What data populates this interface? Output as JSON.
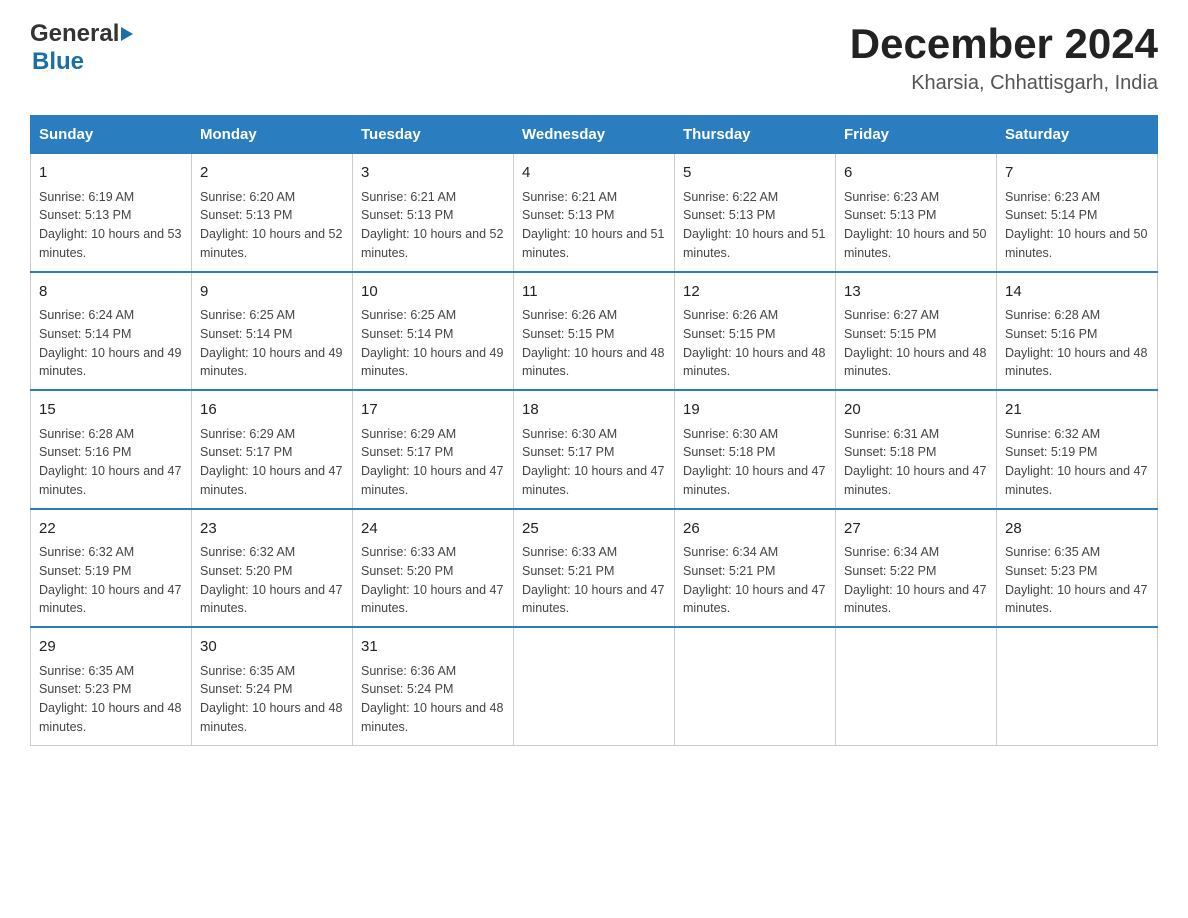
{
  "header": {
    "month_year": "December 2024",
    "location": "Kharsia, Chhattisgarh, India",
    "logo_general": "General",
    "logo_blue": "Blue"
  },
  "days_of_week": [
    "Sunday",
    "Monday",
    "Tuesday",
    "Wednesday",
    "Thursday",
    "Friday",
    "Saturday"
  ],
  "weeks": [
    [
      {
        "date": "1",
        "sunrise": "6:19 AM",
        "sunset": "5:13 PM",
        "daylight": "10 hours and 53 minutes."
      },
      {
        "date": "2",
        "sunrise": "6:20 AM",
        "sunset": "5:13 PM",
        "daylight": "10 hours and 52 minutes."
      },
      {
        "date": "3",
        "sunrise": "6:21 AM",
        "sunset": "5:13 PM",
        "daylight": "10 hours and 52 minutes."
      },
      {
        "date": "4",
        "sunrise": "6:21 AM",
        "sunset": "5:13 PM",
        "daylight": "10 hours and 51 minutes."
      },
      {
        "date": "5",
        "sunrise": "6:22 AM",
        "sunset": "5:13 PM",
        "daylight": "10 hours and 51 minutes."
      },
      {
        "date": "6",
        "sunrise": "6:23 AM",
        "sunset": "5:13 PM",
        "daylight": "10 hours and 50 minutes."
      },
      {
        "date": "7",
        "sunrise": "6:23 AM",
        "sunset": "5:14 PM",
        "daylight": "10 hours and 50 minutes."
      }
    ],
    [
      {
        "date": "8",
        "sunrise": "6:24 AM",
        "sunset": "5:14 PM",
        "daylight": "10 hours and 49 minutes."
      },
      {
        "date": "9",
        "sunrise": "6:25 AM",
        "sunset": "5:14 PM",
        "daylight": "10 hours and 49 minutes."
      },
      {
        "date": "10",
        "sunrise": "6:25 AM",
        "sunset": "5:14 PM",
        "daylight": "10 hours and 49 minutes."
      },
      {
        "date": "11",
        "sunrise": "6:26 AM",
        "sunset": "5:15 PM",
        "daylight": "10 hours and 48 minutes."
      },
      {
        "date": "12",
        "sunrise": "6:26 AM",
        "sunset": "5:15 PM",
        "daylight": "10 hours and 48 minutes."
      },
      {
        "date": "13",
        "sunrise": "6:27 AM",
        "sunset": "5:15 PM",
        "daylight": "10 hours and 48 minutes."
      },
      {
        "date": "14",
        "sunrise": "6:28 AM",
        "sunset": "5:16 PM",
        "daylight": "10 hours and 48 minutes."
      }
    ],
    [
      {
        "date": "15",
        "sunrise": "6:28 AM",
        "sunset": "5:16 PM",
        "daylight": "10 hours and 47 minutes."
      },
      {
        "date": "16",
        "sunrise": "6:29 AM",
        "sunset": "5:17 PM",
        "daylight": "10 hours and 47 minutes."
      },
      {
        "date": "17",
        "sunrise": "6:29 AM",
        "sunset": "5:17 PM",
        "daylight": "10 hours and 47 minutes."
      },
      {
        "date": "18",
        "sunrise": "6:30 AM",
        "sunset": "5:17 PM",
        "daylight": "10 hours and 47 minutes."
      },
      {
        "date": "19",
        "sunrise": "6:30 AM",
        "sunset": "5:18 PM",
        "daylight": "10 hours and 47 minutes."
      },
      {
        "date": "20",
        "sunrise": "6:31 AM",
        "sunset": "5:18 PM",
        "daylight": "10 hours and 47 minutes."
      },
      {
        "date": "21",
        "sunrise": "6:32 AM",
        "sunset": "5:19 PM",
        "daylight": "10 hours and 47 minutes."
      }
    ],
    [
      {
        "date": "22",
        "sunrise": "6:32 AM",
        "sunset": "5:19 PM",
        "daylight": "10 hours and 47 minutes."
      },
      {
        "date": "23",
        "sunrise": "6:32 AM",
        "sunset": "5:20 PM",
        "daylight": "10 hours and 47 minutes."
      },
      {
        "date": "24",
        "sunrise": "6:33 AM",
        "sunset": "5:20 PM",
        "daylight": "10 hours and 47 minutes."
      },
      {
        "date": "25",
        "sunrise": "6:33 AM",
        "sunset": "5:21 PM",
        "daylight": "10 hours and 47 minutes."
      },
      {
        "date": "26",
        "sunrise": "6:34 AM",
        "sunset": "5:21 PM",
        "daylight": "10 hours and 47 minutes."
      },
      {
        "date": "27",
        "sunrise": "6:34 AM",
        "sunset": "5:22 PM",
        "daylight": "10 hours and 47 minutes."
      },
      {
        "date": "28",
        "sunrise": "6:35 AM",
        "sunset": "5:23 PM",
        "daylight": "10 hours and 47 minutes."
      }
    ],
    [
      {
        "date": "29",
        "sunrise": "6:35 AM",
        "sunset": "5:23 PM",
        "daylight": "10 hours and 48 minutes."
      },
      {
        "date": "30",
        "sunrise": "6:35 AM",
        "sunset": "5:24 PM",
        "daylight": "10 hours and 48 minutes."
      },
      {
        "date": "31",
        "sunrise": "6:36 AM",
        "sunset": "5:24 PM",
        "daylight": "10 hours and 48 minutes."
      },
      null,
      null,
      null,
      null
    ]
  ]
}
